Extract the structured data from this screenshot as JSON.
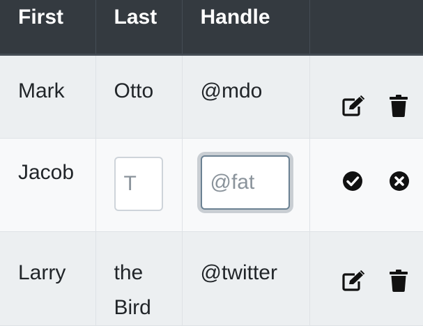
{
  "header": {
    "columns": [
      "First",
      "Last",
      "Handle",
      ""
    ]
  },
  "rows": [
    {
      "first": "Mark",
      "last": "Otto",
      "handle": "@mdo",
      "mode": "view",
      "actions": [
        "edit-icon",
        "trash-icon"
      ]
    },
    {
      "first": "Jacob",
      "last_placeholder": "T",
      "handle_placeholder": "@fat",
      "mode": "edit",
      "actions": [
        "check-circle-icon",
        "x-circle-icon"
      ]
    },
    {
      "first": "Larry",
      "last": "the Bird",
      "handle": "@twitter",
      "mode": "view",
      "actions": [
        "edit-icon",
        "trash-icon"
      ]
    }
  ],
  "colors": {
    "header_bg": "#343a40",
    "row_stripe": "#eceff1",
    "row_plain": "#f8f9fa",
    "icon": "#111111"
  }
}
